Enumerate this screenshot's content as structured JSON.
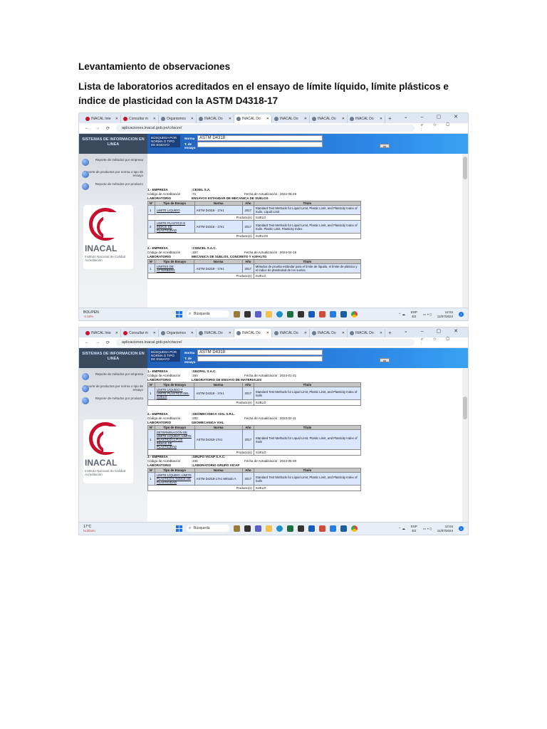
{
  "doc": {
    "heading": "Levantamiento de observaciones",
    "subheading": "Lista de laboratorios acreditados en el ensayo de límite líquido, límite plásticos e índice de plasticidad con la ASTM D4318-17"
  },
  "browser": {
    "tabs": [
      "INACAL Inte",
      "Consultar m",
      "Organismos",
      "INACAL Do",
      "INACAL Do",
      "INACAL Do",
      "INACAL Do",
      "INACAL Do"
    ],
    "url": "aplicaciones.inacal.gob.pe/crtacre/"
  },
  "sidebar": {
    "system_title": "SISTEMAS DE INFORMACION EN LINEA",
    "menu": [
      "Reporte de métodos por empresa",
      "Reporte de productos por norma o tipo de ensayo",
      "Reporte de métodos por producto"
    ],
    "logo_name": "INACAL",
    "logo_sub": "Instituto Nacional de Calidad",
    "logo_sub2": "Acreditación"
  },
  "form": {
    "panel_label": "BÚSQUEDA POR NORMA O TIPO DE ENSAYO",
    "norma_label": "Norma",
    "tipo_label": "T. de ensayo",
    "norma_value": "ASTM D4318",
    "ok": "ok"
  },
  "labels": {
    "empresa": "EMPRESA",
    "codigo": "Código de Acreditación",
    "fecha": "Fecha de Actualización :",
    "laboratorio": "LABORATORIO",
    "producto": "Producto(s)",
    "headers": [
      "N°",
      "Tipo de Ensayo",
      "Norma",
      "Año",
      "Título"
    ]
  },
  "shot1": {
    "records": [
      {
        "num": "1.-",
        "empresa": ":CESEL S.A.",
        "codigo": ":71",
        "fecha": "2022-08-29",
        "laboratorio": "ENSAYOS ESTANDAR DE MECANICA DE SUELOS",
        "rows": [
          {
            "n": "1",
            "tipo": "LIMITE LIQUIDO",
            "norma": "ASTM D4318 - 17e1",
            "anio": "2017",
            "titulo": "Standard Test Methods for Liquid Limit, Plastic Limit, and Plasticity Index of Soils. Liquid Limit",
            "producto": "SUELO"
          },
          {
            "n": "2",
            "tipo": "LIMITE PLASTICO E INDICE DE PLASTICIDAD",
            "norma": "ASTM D4318 - 17e1",
            "anio": "2017",
            "titulo": "Standard Test Methods for Liquid Limit, Plastic Limit, and Plasticity Index of Soils. Plastic Limit. Plasticity Index",
            "producto": "SUELOS"
          }
        ]
      },
      {
        "num": "2.-",
        "empresa": ":CONCEL S.A.C.",
        "codigo": ":157",
        "fecha": "2024-04-18",
        "laboratorio": "MECÁNICA DE SUELOS, CONCRETO Y ASFALTO",
        "rows": [
          {
            "n": "1",
            "tipo": "LIMITES DE ATTERBERG",
            "norma": "ASTM D4318 - 17e1",
            "anio": "2017",
            "titulo": "Métodos de prueba estándar para el límite de líquido, el límite de plástico y el índice de plasticidad de los suelos.",
            "producto": "SUELO"
          }
        ]
      }
    ],
    "taskbar": {
      "weather_temp": "BOL/PEN",
      "weather_desc": "-0.63%",
      "search": "Búsqueda",
      "lang": "ESP",
      "lang2": "ES",
      "time": "12:04",
      "date": "11/07/2024"
    }
  },
  "shot2": {
    "records": [
      {
        "num": "1.-",
        "empresa": ":GEOPAL S.A.C.",
        "codigo": ":164",
        "fecha": "2024-01-31",
        "laboratorio": "LABORATORIO DE ENSAYO DE MATERIALES",
        "rows": [
          {
            "n": "1",
            "tipo": "LÍMITE LÍQUIDO Y LÍMITE PLÁSTICO DEL SUELO",
            "norma": "ASTM D4318 - 17e1",
            "anio": "2017",
            "titulo": "Standard Test Methods for Liquid Limit, Plastic Limit, and Plasticity Index of Soils",
            "producto": "SUELO"
          }
        ]
      },
      {
        "num": "2.-",
        "empresa": ":GEOMECANICA VIAL S.R.L.",
        "codigo": ":202",
        "fecha": "2023-02-11",
        "laboratorio": "GEOMECANICA VIAL",
        "rows": [
          {
            "n": "1",
            "tipo": "DETERMINACIÓN DE LÍMITE LÍQUIDO, LÍMITE PLÁSTICO (L.P.) E ÍNDICE DE PLASTICIDAD",
            "norma": "ASTM D4318-17e1",
            "anio": "2017",
            "titulo": "Standard Test Methods for Liquid Limit, Plastic Limit, and Plasticity Index of Soils",
            "producto": "SUELO"
          }
        ]
      },
      {
        "num": "3.-",
        "empresa": ":GRUPO VICAP S.A.C.",
        "codigo": ":236",
        "fecha": "2024-05-30",
        "laboratorio": ":LABORATORIO GRUPO VICAP",
        "rows": [
          {
            "n": "1",
            "tipo": "LÍMITE LÍQUIDO, LÍMITE PLÁSTICO E ÍNDICE DE PLASTICIDAD",
            "norma": "ASTM D4318-17e1 Método A",
            "anio": "2017",
            "titulo": "Standard Test Methods for Liquid Limit, Plastic Limit, and Plasticity Index of Soils",
            "producto": "SUELO"
          }
        ]
      }
    ],
    "taskbar": {
      "weather_temp": "17°C",
      "weather_desc": "Nublado",
      "search": "Búsqueda",
      "lang": "ESP",
      "lang2": "ES",
      "time": "12:04",
      "date": "11/07/2024"
    }
  },
  "colors": {
    "header_blue": "#2d87e6",
    "row_blue": "#dbe6ff",
    "inacal_red": "#c8102e"
  }
}
